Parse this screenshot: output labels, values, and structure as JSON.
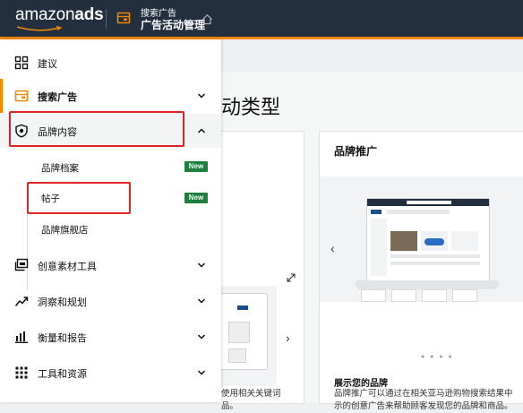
{
  "header": {
    "logo_prefix": "amazon",
    "logo_suffix": "ads",
    "breadcrumb_top": "搜索广告",
    "breadcrumb_bottom": "广告活动管理"
  },
  "sidebar": {
    "items": [
      {
        "label": "建议",
        "icon": "dashboard-grid-icon"
      },
      {
        "label": "搜索广告",
        "icon": "campaign-icon"
      },
      {
        "label": "品牌内容",
        "icon": "shield-icon"
      },
      {
        "label": "创意素材工具",
        "icon": "image-icon"
      },
      {
        "label": "洞察和规划",
        "icon": "trend-icon"
      },
      {
        "label": "衡量和报告",
        "icon": "bar-chart-icon"
      },
      {
        "label": "工具和资源",
        "icon": "apps-grid-icon"
      }
    ],
    "brand_sub": [
      {
        "label": "品牌档案",
        "badge": "New"
      },
      {
        "label": "帖子",
        "badge": "New"
      },
      {
        "label": "品牌旗舰店",
        "badge": ""
      }
    ]
  },
  "main": {
    "heading": "动类型",
    "left_desc_line1": "使用相关关键词",
    "left_desc_line2": "品。",
    "card": {
      "title": "品牌推广",
      "subtitle": "展示您的品牌",
      "desc_line1": "品牌推广可以通过在相关亚马逊购物搜索结果中",
      "desc_line2": "示的创意广告来帮助顾客发现您的品牌和商品。",
      "dots": "● ● ● ●"
    }
  },
  "colors": {
    "topbar": "#232f3e",
    "accent": "#f08804",
    "highlight": "#e02424",
    "badge": "#1e7f3e"
  }
}
